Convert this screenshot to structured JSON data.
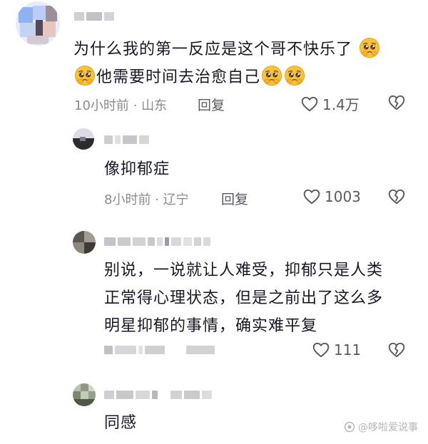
{
  "comments": [
    {
      "text_line1": "为什么我的第一反应是这个哥不快乐了",
      "text_line2": "他需要时间去治愈自己",
      "time_location": "10小时前 · 山东",
      "reply_label": "回复",
      "likes": "1.4万"
    },
    {
      "text_line1": "像抑郁症",
      "time_location": "8小时前 · 辽宁",
      "reply_label": "回复",
      "likes": "1003"
    },
    {
      "text_line1": "别说，一说就让人难受，抑郁只是人类",
      "text_line2": "正常得心理状态，但是之前出了这么多",
      "text_line3": "明星抑郁的事情，确实难平复",
      "likes": "111"
    },
    {
      "text_line1": "同感"
    }
  ],
  "watermark": "@哆啦爱说事",
  "icons": {
    "like": "heart-outline-icon",
    "dislike": "broken-heart-icon",
    "emoji": "pleading-face-emoji"
  },
  "colors": {
    "text": "#161823",
    "meta": "#8a8b91",
    "icon": "#5a5b61"
  }
}
